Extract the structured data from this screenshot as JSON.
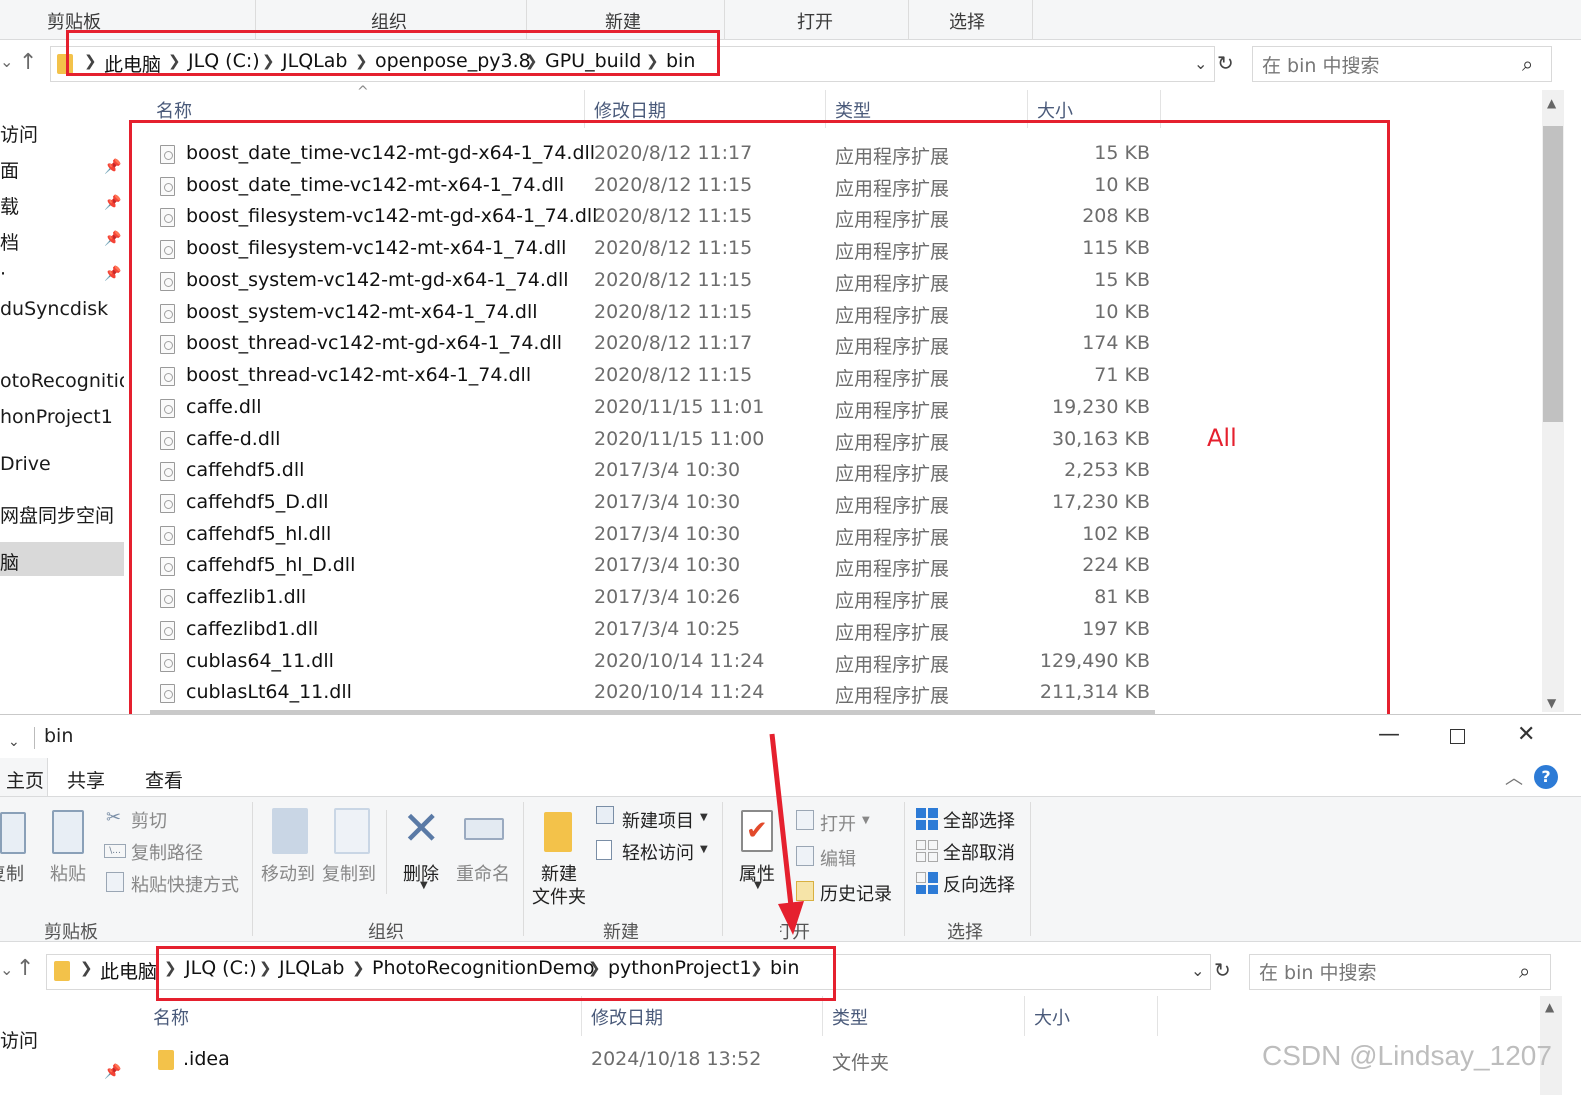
{
  "top_window": {
    "ribbon_groups": [
      "剪贴板",
      "组织",
      "新建",
      "打开",
      "选择"
    ],
    "breadcrumb": [
      "此电脑",
      "JLQ (C:)",
      "JLQLab",
      "openpose_py3.8",
      "GPU_build",
      "bin"
    ],
    "search_placeholder": "在 bin 中搜索",
    "nav_items": [
      "访问",
      "面",
      "载",
      "档",
      "·",
      "duSyncdisk",
      "otoRecognition",
      "honProject1",
      "Drive",
      "网盘同步空间",
      "脑"
    ],
    "columns": [
      "名称",
      "修改日期",
      "类型",
      "大小"
    ],
    "files": [
      {
        "name": "boost_date_time-vc142-mt-gd-x64-1_74.dll",
        "date": "2020/8/12 11:17",
        "type": "应用程序扩展",
        "size": "15 KB"
      },
      {
        "name": "boost_date_time-vc142-mt-x64-1_74.dll",
        "date": "2020/8/12 11:15",
        "type": "应用程序扩展",
        "size": "10 KB"
      },
      {
        "name": "boost_filesystem-vc142-mt-gd-x64-1_74.dll",
        "date": "2020/8/12 11:15",
        "type": "应用程序扩展",
        "size": "208 KB"
      },
      {
        "name": "boost_filesystem-vc142-mt-x64-1_74.dll",
        "date": "2020/8/12 11:15",
        "type": "应用程序扩展",
        "size": "115 KB"
      },
      {
        "name": "boost_system-vc142-mt-gd-x64-1_74.dll",
        "date": "2020/8/12 11:15",
        "type": "应用程序扩展",
        "size": "15 KB"
      },
      {
        "name": "boost_system-vc142-mt-x64-1_74.dll",
        "date": "2020/8/12 11:15",
        "type": "应用程序扩展",
        "size": "10 KB"
      },
      {
        "name": "boost_thread-vc142-mt-gd-x64-1_74.dll",
        "date": "2020/8/12 11:17",
        "type": "应用程序扩展",
        "size": "174 KB"
      },
      {
        "name": "boost_thread-vc142-mt-x64-1_74.dll",
        "date": "2020/8/12 11:15",
        "type": "应用程序扩展",
        "size": "71 KB"
      },
      {
        "name": "caffe.dll",
        "date": "2020/11/15 11:01",
        "type": "应用程序扩展",
        "size": "19,230 KB"
      },
      {
        "name": "caffe-d.dll",
        "date": "2020/11/15 11:00",
        "type": "应用程序扩展",
        "size": "30,163 KB"
      },
      {
        "name": "caffehdf5.dll",
        "date": "2017/3/4 10:30",
        "type": "应用程序扩展",
        "size": "2,253 KB"
      },
      {
        "name": "caffehdf5_D.dll",
        "date": "2017/3/4 10:30",
        "type": "应用程序扩展",
        "size": "17,230 KB"
      },
      {
        "name": "caffehdf5_hl.dll",
        "date": "2017/3/4 10:30",
        "type": "应用程序扩展",
        "size": "102 KB"
      },
      {
        "name": "caffehdf5_hl_D.dll",
        "date": "2017/3/4 10:30",
        "type": "应用程序扩展",
        "size": "224 KB"
      },
      {
        "name": "caffezlib1.dll",
        "date": "2017/3/4 10:26",
        "type": "应用程序扩展",
        "size": "81 KB"
      },
      {
        "name": "caffezlibd1.dll",
        "date": "2017/3/4 10:25",
        "type": "应用程序扩展",
        "size": "197 KB"
      },
      {
        "name": "cublas64_11.dll",
        "date": "2020/10/14 11:24",
        "type": "应用程序扩展",
        "size": "129,490 KB"
      },
      {
        "name": "cublasLt64_11.dll",
        "date": "2020/10/14 11:24",
        "type": "应用程序扩展",
        "size": "211,314 KB"
      }
    ],
    "annotation_label": "All"
  },
  "bottom_window": {
    "title": "bin",
    "tabs": [
      "主页",
      "共享",
      "查看"
    ],
    "clipboard": {
      "copy": "复制",
      "paste": "粘贴",
      "cut": "剪切",
      "copy_path": "复制路径",
      "paste_shortcut": "粘贴快捷方式",
      "group": "剪贴板"
    },
    "organize": {
      "move_to": "移动到",
      "copy_to": "复制到",
      "delete": "删除",
      "rename": "重命名",
      "group": "组织"
    },
    "new": {
      "new_item": "新建项目",
      "easy_access": "轻松访问",
      "new_folder_1": "新建",
      "new_folder_2": "文件夹",
      "group": "新建"
    },
    "open": {
      "properties": "属性",
      "open": "打开",
      "edit": "编辑",
      "history": "历史记录",
      "group": "打开"
    },
    "select": {
      "select_all": "全部选择",
      "select_none": "全部取消",
      "invert": "反向选择",
      "group": "选择"
    },
    "breadcrumb": [
      "此电脑",
      "JLQ (C:)",
      "JLQLab",
      "PhotoRecognitionDemo",
      "pythonProject1",
      "bin"
    ],
    "search_placeholder": "在 bin 中搜索",
    "nav_items": [
      "访问"
    ],
    "columns": [
      "名称",
      "修改日期",
      "类型",
      "大小"
    ],
    "files": [
      {
        "name": ".idea",
        "date": "2024/10/18 13:52",
        "type": "文件夹"
      }
    ],
    "help_glyph": "?"
  },
  "watermark": "CSDN @Lindsay_1207",
  "colors": {
    "annotation_red": "#e5202e",
    "folder_yellow": "#f3c24a",
    "select_blue": "#2d7bd6"
  }
}
